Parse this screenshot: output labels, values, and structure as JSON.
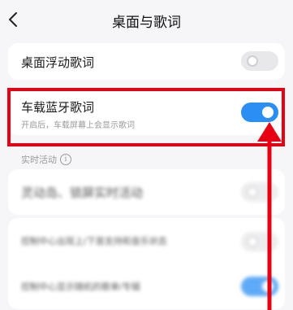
{
  "header": {
    "title": "桌面与歌词"
  },
  "settings": {
    "desktop_lyrics": {
      "label": "桌面浮动歌词",
      "enabled": false
    },
    "car_bluetooth_lyrics": {
      "label": "车载蓝牙歌词",
      "description": "开启后，车载屏幕上会显示歌词",
      "enabled": true
    },
    "live_activity_section": "实时活动",
    "dynamic_island": {
      "label": "灵动岛、锁屏实时活动",
      "enabled": false
    },
    "blurred_row_1": {
      "label": "控制中心出现上/下首支持和音乐状态",
      "enabled": false
    },
    "blurred_row_2": {
      "label": "控制中心显示随机的歌单/专辑",
      "enabled": true
    }
  },
  "colors": {
    "accent": "#2a8ef5",
    "highlight": "#e60012"
  }
}
